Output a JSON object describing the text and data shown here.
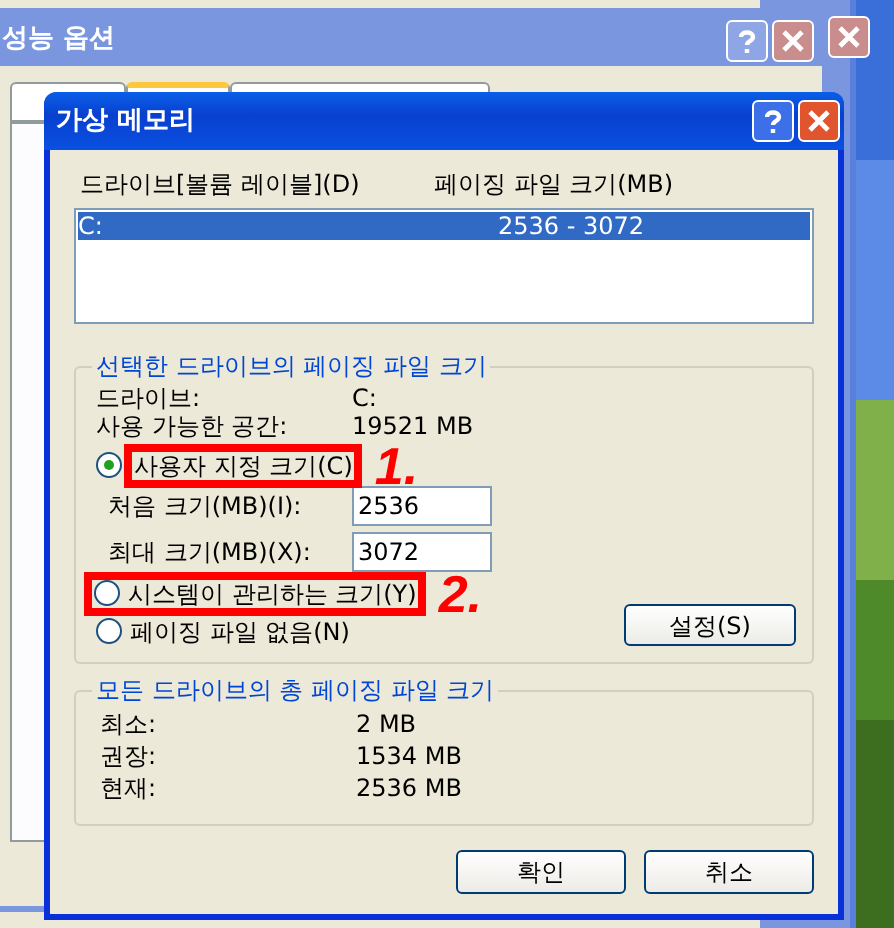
{
  "back_window": {
    "title": "성능 옵션",
    "tabs": [
      {
        "selected": false
      },
      {
        "selected": true
      },
      {
        "selected": false
      }
    ]
  },
  "dialog": {
    "title": "가상 메모리",
    "list": {
      "columns": [
        "드라이브[볼륨 레이블](D)",
        "페이징 파일 크기(MB)"
      ],
      "rows": [
        {
          "drive": "C:",
          "size": "2536 - 3072",
          "selected": true
        }
      ]
    },
    "selected_drive": {
      "title": "선택한 드라이브의 페이징 파일 크기",
      "info": [
        {
          "label": "드라이브:",
          "value": "C:"
        },
        {
          "label": "사용 가능한 공간:",
          "value": "19521 MB"
        }
      ],
      "options": [
        {
          "kind": "radio",
          "label": "사용자 지정 크기(C)",
          "selected": true,
          "highlighted": true,
          "frame_includes_radio": false,
          "annotation": "1."
        },
        {
          "kind": "fields",
          "fields": [
            {
              "label": "처음 크기(MB)(I):",
              "value": "2536"
            },
            {
              "label": "최대 크기(MB)(X):",
              "value": "3072"
            }
          ]
        },
        {
          "kind": "radio",
          "label": "시스템이 관리하는 크기(Y)",
          "selected": false,
          "highlighted": true,
          "frame_includes_radio": true,
          "annotation": "2."
        },
        {
          "kind": "radio",
          "label": "페이징 파일 없음(N)",
          "selected": false
        }
      ],
      "set_button": "설정(S)"
    },
    "totals": {
      "title": "모든 드라이브의 총 페이징 파일 크기",
      "rows": [
        {
          "label": "최소:",
          "value": "2 MB"
        },
        {
          "label": "권장:",
          "value": "1534 MB"
        },
        {
          "label": "현재:",
          "value": "2536 MB"
        }
      ]
    },
    "buttons": [
      "확인",
      "취소"
    ]
  }
}
